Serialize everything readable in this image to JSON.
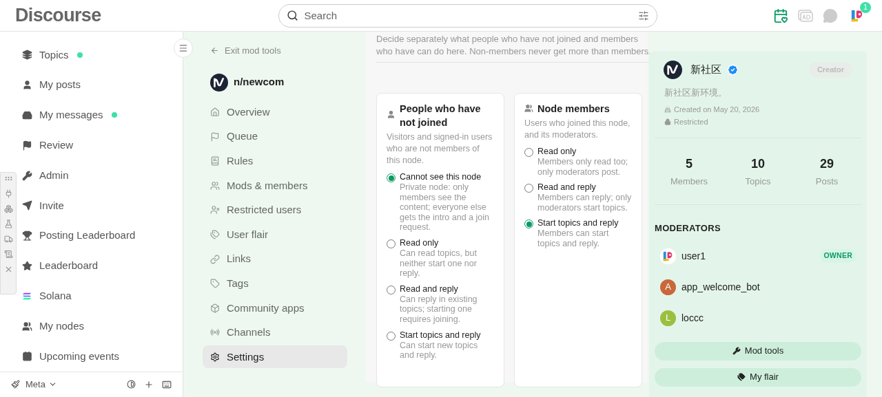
{
  "header": {
    "logo": "Discourse",
    "search": {
      "placeholder": "Search"
    },
    "notification_count": "1"
  },
  "sidebar": {
    "items": [
      {
        "label": "Topics",
        "unread": true
      },
      {
        "label": "My posts",
        "unread": false
      },
      {
        "label": "My messages",
        "unread": true
      },
      {
        "label": "Review",
        "unread": false
      },
      {
        "label": "Admin",
        "unread": false
      },
      {
        "label": "Invite",
        "unread": false
      },
      {
        "label": "Posting Leaderboard",
        "unread": false
      },
      {
        "label": "Leaderboard",
        "unread": false
      },
      {
        "label": "Solana",
        "unread": false
      },
      {
        "label": "My nodes",
        "unread": false
      },
      {
        "label": "Upcoming events",
        "unread": false
      }
    ],
    "footer": {
      "label": "Meta"
    }
  },
  "mod_nav": {
    "exit": "Exit mod tools",
    "node": "n/newcom",
    "items": [
      {
        "label": "Overview",
        "selected": false
      },
      {
        "label": "Queue",
        "selected": false
      },
      {
        "label": "Rules",
        "selected": false
      },
      {
        "label": "Mods & members",
        "selected": false
      },
      {
        "label": "Restricted users",
        "selected": false
      },
      {
        "label": "User flair",
        "selected": false
      },
      {
        "label": "Links",
        "selected": false
      },
      {
        "label": "Tags",
        "selected": false
      },
      {
        "label": "Community apps",
        "selected": false
      },
      {
        "label": "Channels",
        "selected": false
      },
      {
        "label": "Settings",
        "selected": true
      }
    ]
  },
  "main": {
    "intro": "Decide separately what people who have not joined and members who have can do here. Non-members never get more than members.",
    "cards": [
      {
        "title": "People who have not joined",
        "description": "Visitors and signed-in users who are not members of this node.",
        "options": [
          {
            "label": "Cannot see this node",
            "description": "Private node: only members see the content; everyone else gets the intro and a join request.",
            "selected": true
          },
          {
            "label": "Read only",
            "description": "Can read topics, but neither start one nor reply.",
            "selected": false
          },
          {
            "label": "Read and reply",
            "description": "Can reply in existing topics; starting one requires joining.",
            "selected": false
          },
          {
            "label": "Start topics and reply",
            "description": "Can start new topics and reply.",
            "selected": false
          }
        ]
      },
      {
        "title": "Node members",
        "description": "Users who joined this node, and its moderators.",
        "options": [
          {
            "label": "Read only",
            "description": "Members only read too; only moderators post.",
            "selected": false
          },
          {
            "label": "Read and reply",
            "description": "Members can reply; only moderators start topics.",
            "selected": false
          },
          {
            "label": "Start topics and reply",
            "description": "Members can start topics and reply.",
            "selected": true
          }
        ]
      }
    ]
  },
  "node_panel": {
    "name": "新社区",
    "verified": true,
    "role": "Creator",
    "description": "新社区新环境。",
    "created": "Created on May 20, 2026",
    "access": "Restricted",
    "stats": [
      {
        "value": "5",
        "label": "Members"
      },
      {
        "value": "10",
        "label": "Topics"
      },
      {
        "value": "29",
        "label": "Posts"
      }
    ],
    "moderators_heading": "MODERATORS",
    "moderators": [
      {
        "name": "user1",
        "kind": "image",
        "badge": "OWNER"
      },
      {
        "name": "app_welcome_bot",
        "kind": "letter",
        "initial": "A",
        "color": "#c8683a"
      },
      {
        "name": "loccc",
        "kind": "letter",
        "initial": "L",
        "color": "#9bbf3f"
      }
    ],
    "buttons": [
      "Mod tools",
      "My flair"
    ]
  }
}
